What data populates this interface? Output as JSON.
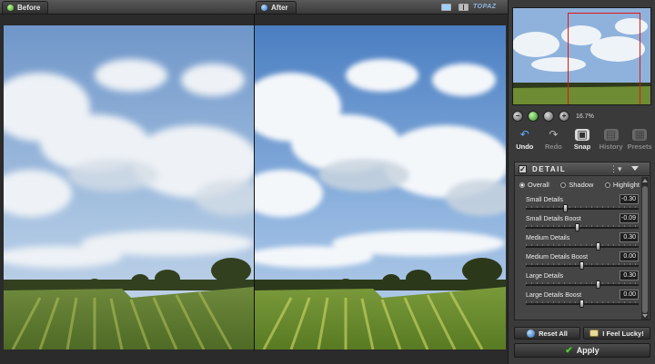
{
  "panes": {
    "before_label": "Before",
    "after_label": "After"
  },
  "logo": {
    "text": "TOPAZ"
  },
  "navigator": {
    "zoom_level": "16.7%",
    "zoom_icons": [
      "zoom-out-icon",
      "zoom-fit-icon",
      "zoom-actual-icon",
      "zoom-in-icon"
    ]
  },
  "actions": {
    "undo": "Undo",
    "redo": "Redo",
    "snap": "Snap",
    "history": "History",
    "presets": "Presets"
  },
  "detail": {
    "title": "DETAIL",
    "checked": true,
    "tones": [
      {
        "label": "Overall",
        "selected": true
      },
      {
        "label": "Shadow",
        "selected": false
      },
      {
        "label": "Highlight",
        "selected": false
      }
    ],
    "sliders": [
      {
        "label": "Small Details",
        "value": "-0.30",
        "level": -0.3
      },
      {
        "label": "Small Details Boost",
        "value": "-0.09",
        "level": -0.09
      },
      {
        "label": "Medium Details",
        "value": "0.30",
        "level": 0.3
      },
      {
        "label": "Medium Details Boost",
        "value": "0.00",
        "level": 0.0
      },
      {
        "label": "Large Details",
        "value": "0.30",
        "level": 0.3
      },
      {
        "label": "Large Details Boost",
        "value": "0.00",
        "level": 0.0
      }
    ]
  },
  "buttons": {
    "reset": "Reset All",
    "lucky": "I Feel Lucky!",
    "apply": "Apply"
  },
  "colors": {
    "accent_green": "#3fa514",
    "accent_blue": "#2d78cc",
    "nav_rect": "#e01414"
  }
}
